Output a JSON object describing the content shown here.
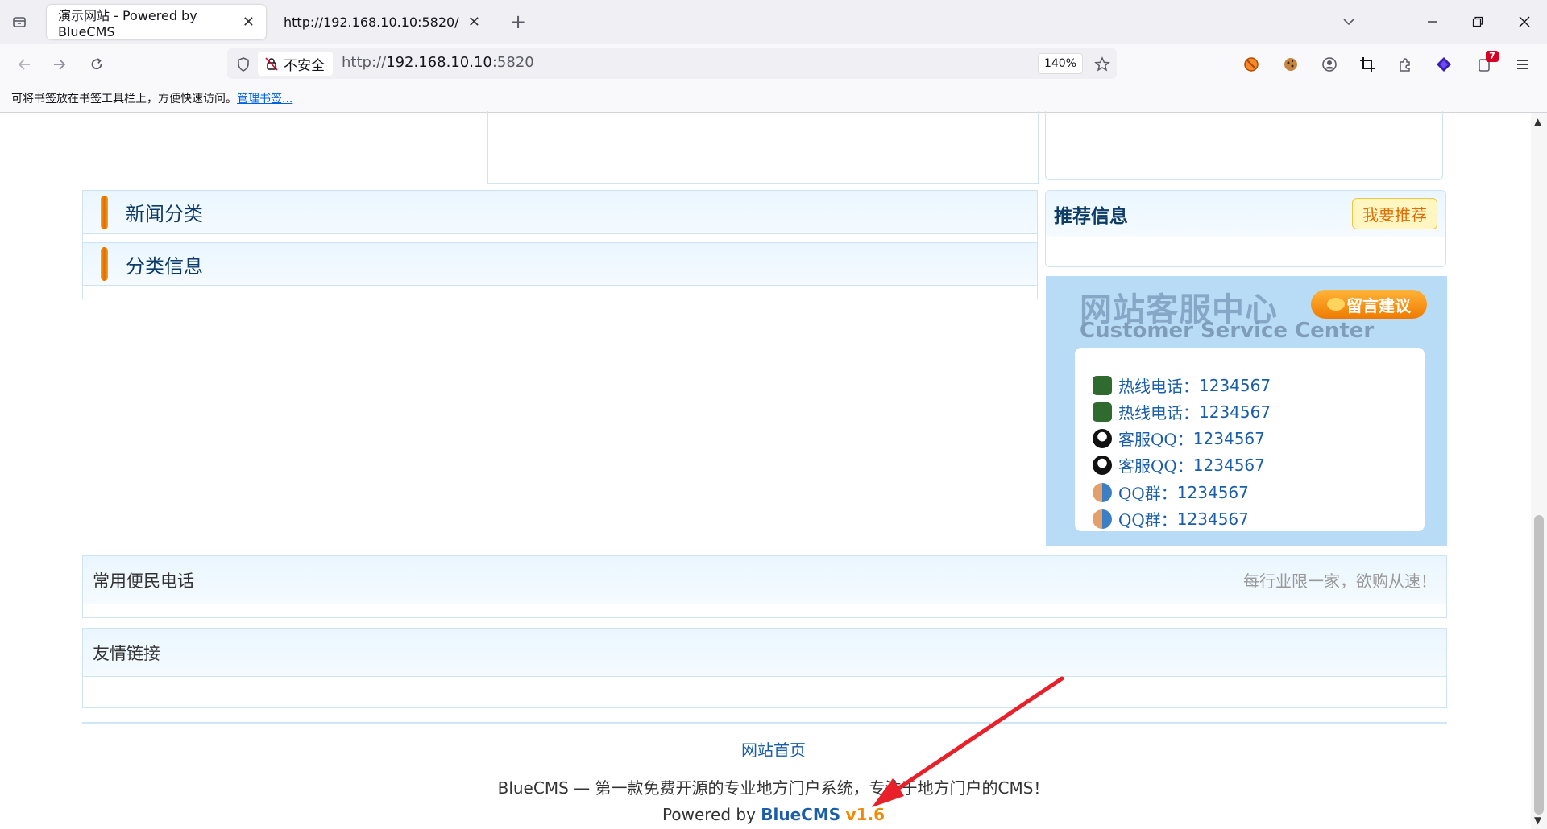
{
  "browser": {
    "tabs": [
      {
        "title": "演示网站 - Powered by BlueCMS",
        "active": true
      },
      {
        "title": "http://192.168.10.10:5820/",
        "active": false
      }
    ],
    "security_label": "不安全",
    "url_scheme": "http://",
    "url_host": "192.168.10.10",
    "url_port": ":5820",
    "zoom": "140%",
    "bookmarks_hint": "可将书签放在书签工具栏上，方便快速访问。",
    "bookmarks_link": "管理书签...",
    "extension_badge": "7"
  },
  "page": {
    "sections": {
      "news_category": "新闻分类",
      "classified": "分类信息",
      "recommend": "推荐信息",
      "recommend_button": "我要推荐",
      "phones": "常用便民电话",
      "phones_slogan": "每行业限一家，欲购从速！",
      "links": "友情链接"
    },
    "customer_service": {
      "title": "网站客服中心",
      "subtitle": "Customer Service Center",
      "button": "留言建议",
      "items": [
        {
          "label": "热线电话：",
          "value": "1234567",
          "icon": "phone-icon"
        },
        {
          "label": "热线电话：",
          "value": "1234567",
          "icon": "phone-icon"
        },
        {
          "label": "客服QQ：",
          "value": "1234567",
          "icon": "qq-penguin-icon"
        },
        {
          "label": "客服QQ：",
          "value": "1234567",
          "icon": "qq-penguin-icon"
        },
        {
          "label": "QQ群：",
          "value": "1234567",
          "icon": "qq-group-icon"
        },
        {
          "label": "QQ群：",
          "value": "1234567",
          "icon": "qq-group-icon"
        }
      ]
    },
    "footer": {
      "home_link": "网站首页",
      "tagline": "BlueCMS — 第一款免费开源的专业地方门户系统，专注于地方门户的CMS！",
      "powered_prefix": "Powered by ",
      "powered_brand": "BlueCMS",
      "powered_version": "v1.6"
    }
  },
  "colors": {
    "accent_blue": "#1a5da8",
    "annotation_red": "#e8202a",
    "orange": "#f07a00"
  }
}
